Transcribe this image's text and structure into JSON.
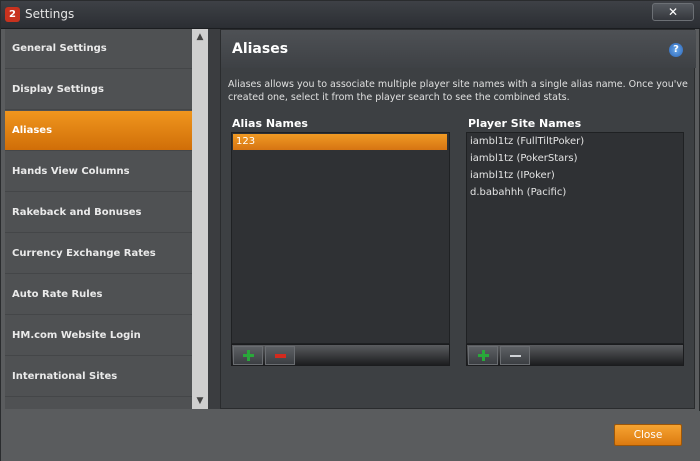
{
  "window": {
    "title": "Settings",
    "app_icon": "2",
    "close_glyph": "✕"
  },
  "sidebar": {
    "items": [
      {
        "label": "General Settings",
        "active": false
      },
      {
        "label": "Display Settings",
        "active": false
      },
      {
        "label": "Aliases",
        "active": true
      },
      {
        "label": "Hands View Columns",
        "active": false
      },
      {
        "label": "Rakeback and Bonuses",
        "active": false
      },
      {
        "label": "Currency Exchange Rates",
        "active": false
      },
      {
        "label": "Auto Rate Rules",
        "active": false
      },
      {
        "label": "HM.com Website Login",
        "active": false
      },
      {
        "label": "International Sites",
        "active": false
      }
    ]
  },
  "scrollbar": {
    "up_glyph": "▲",
    "down_glyph": "▼"
  },
  "panel": {
    "title": "Aliases",
    "help_glyph": "?",
    "description": "Aliases allows you to associate multiple player site names with a single alias name.  Once you've created one, select it from the player search to see the combined stats."
  },
  "aliases": {
    "label": "Alias Names",
    "items": [
      "123"
    ],
    "selected": "123"
  },
  "sites": {
    "label": "Player Site Names",
    "items": [
      "iambl1tz (FullTiltPoker)",
      "iambl1tz (PokerStars)",
      "iambl1tz (IPoker)",
      "d.babahhh (Pacific)"
    ]
  },
  "footer": {
    "close_label": "Close"
  },
  "colors": {
    "accent": "#e8861a",
    "panel_bg": "#3d4043",
    "list_bg": "#2f3134",
    "add_green": "#29a83a",
    "remove_red": "#d32a1e"
  }
}
